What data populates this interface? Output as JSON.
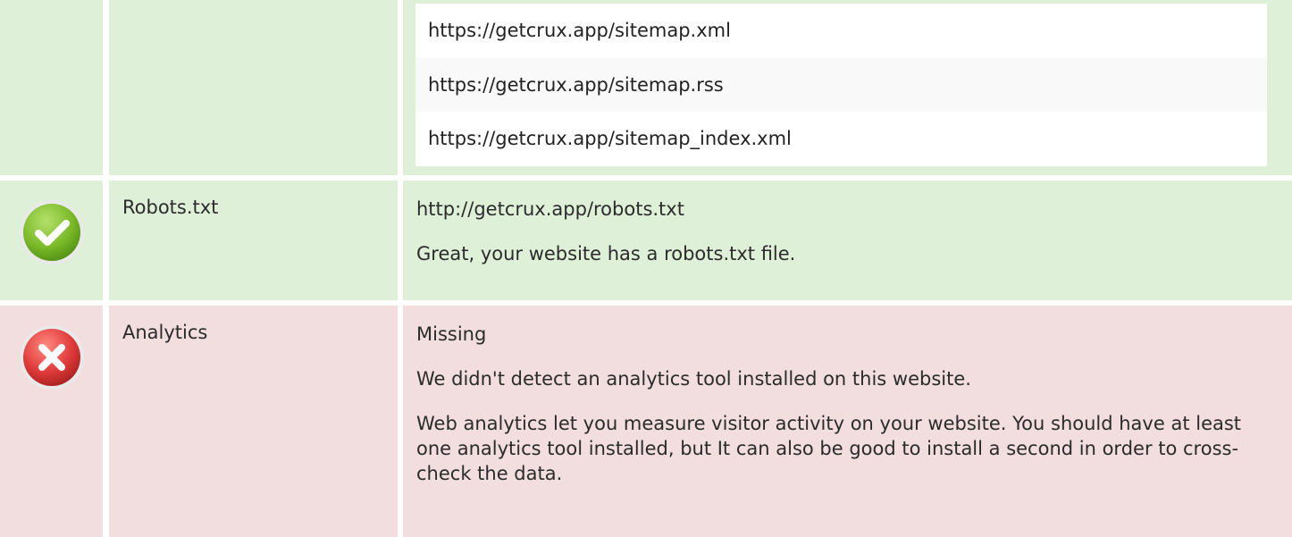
{
  "sitemaps": {
    "urls": [
      "https://getcrux.app/sitemap.xml",
      "https://getcrux.app/sitemap.rss",
      "https://getcrux.app/sitemap_index.xml"
    ]
  },
  "robots": {
    "status": "pass",
    "status_icon": "check-circle-icon",
    "status_color": "#7cbb2a",
    "label": "Robots.txt",
    "value": "http://getcrux.app/robots.txt",
    "message": "Great, your website has a robots.txt file."
  },
  "analytics": {
    "status": "fail",
    "status_icon": "x-circle-icon",
    "status_color": "#e03b3b",
    "label": "Analytics",
    "value": "Missing",
    "message": "We didn't detect an analytics tool installed on this website.",
    "advice": "Web analytics let you measure visitor activity on your website. You should have at least one analytics tool installed, but It can also be good to install a second in order to cross-check the data."
  },
  "colors": {
    "pass_bg": "#dff0d8",
    "fail_bg": "#f2dede"
  }
}
